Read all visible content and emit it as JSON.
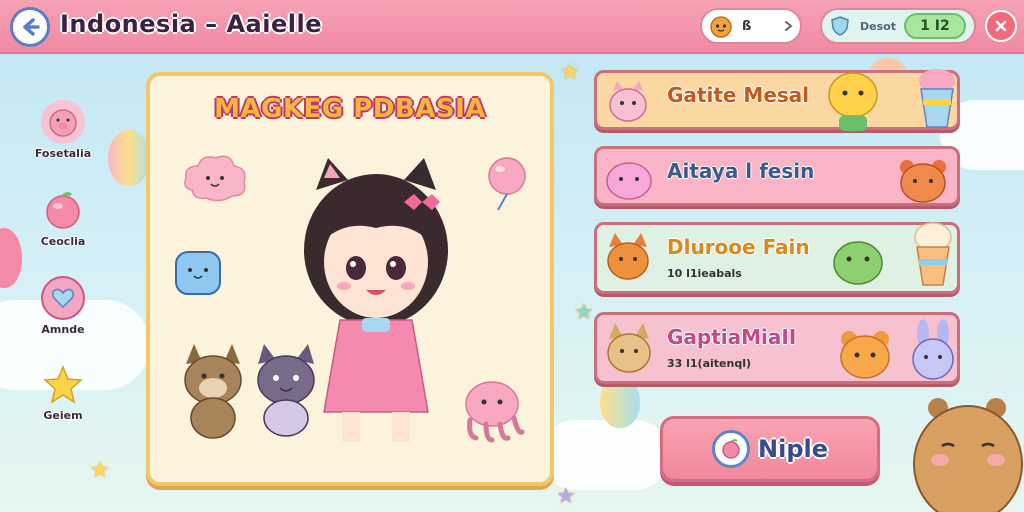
{
  "header": {
    "title": "Indonesia – Aaielle",
    "coin_value": "ß",
    "energy_label": "Desot",
    "energy_value": "1 I2"
  },
  "sidebar": {
    "items": [
      {
        "label": "Fosetalia",
        "icon": "pig-icon",
        "color": "#f6a0b8"
      },
      {
        "label": "Ceoclia",
        "icon": "peach-icon",
        "color": "#f48aa8"
      },
      {
        "label": "Amnde",
        "icon": "heart-icon",
        "color": "#e87aa0"
      },
      {
        "label": "Geiem",
        "icon": "star-icon",
        "color": "#ffd24a"
      }
    ]
  },
  "card": {
    "title": "MAGKEG PDBASIA"
  },
  "entries": [
    {
      "title": "Gatite Mesal",
      "subtitle": "",
      "bg": "#fbd7a2",
      "title_color": "#c25a1e"
    },
    {
      "title": "Aitaya l fesin",
      "subtitle": "",
      "bg": "#f9b5c6",
      "title_color": "#3a5a8a"
    },
    {
      "title": "Dlurooe Fain",
      "subtitle": "10 l1ieabals",
      "bg": "#dff1e2",
      "title_color": "#d88a1e"
    },
    {
      "title": "GaptiaMiaII",
      "subtitle": "33 l1(aitenql)",
      "bg": "#f6c2d0",
      "title_color": "#c04a8a"
    }
  ],
  "play_button": {
    "label": "Niple"
  },
  "colors": {
    "topbar": "#f08aa2",
    "card_border": "#f2c86a",
    "accent_blue": "#5a7fc8"
  }
}
